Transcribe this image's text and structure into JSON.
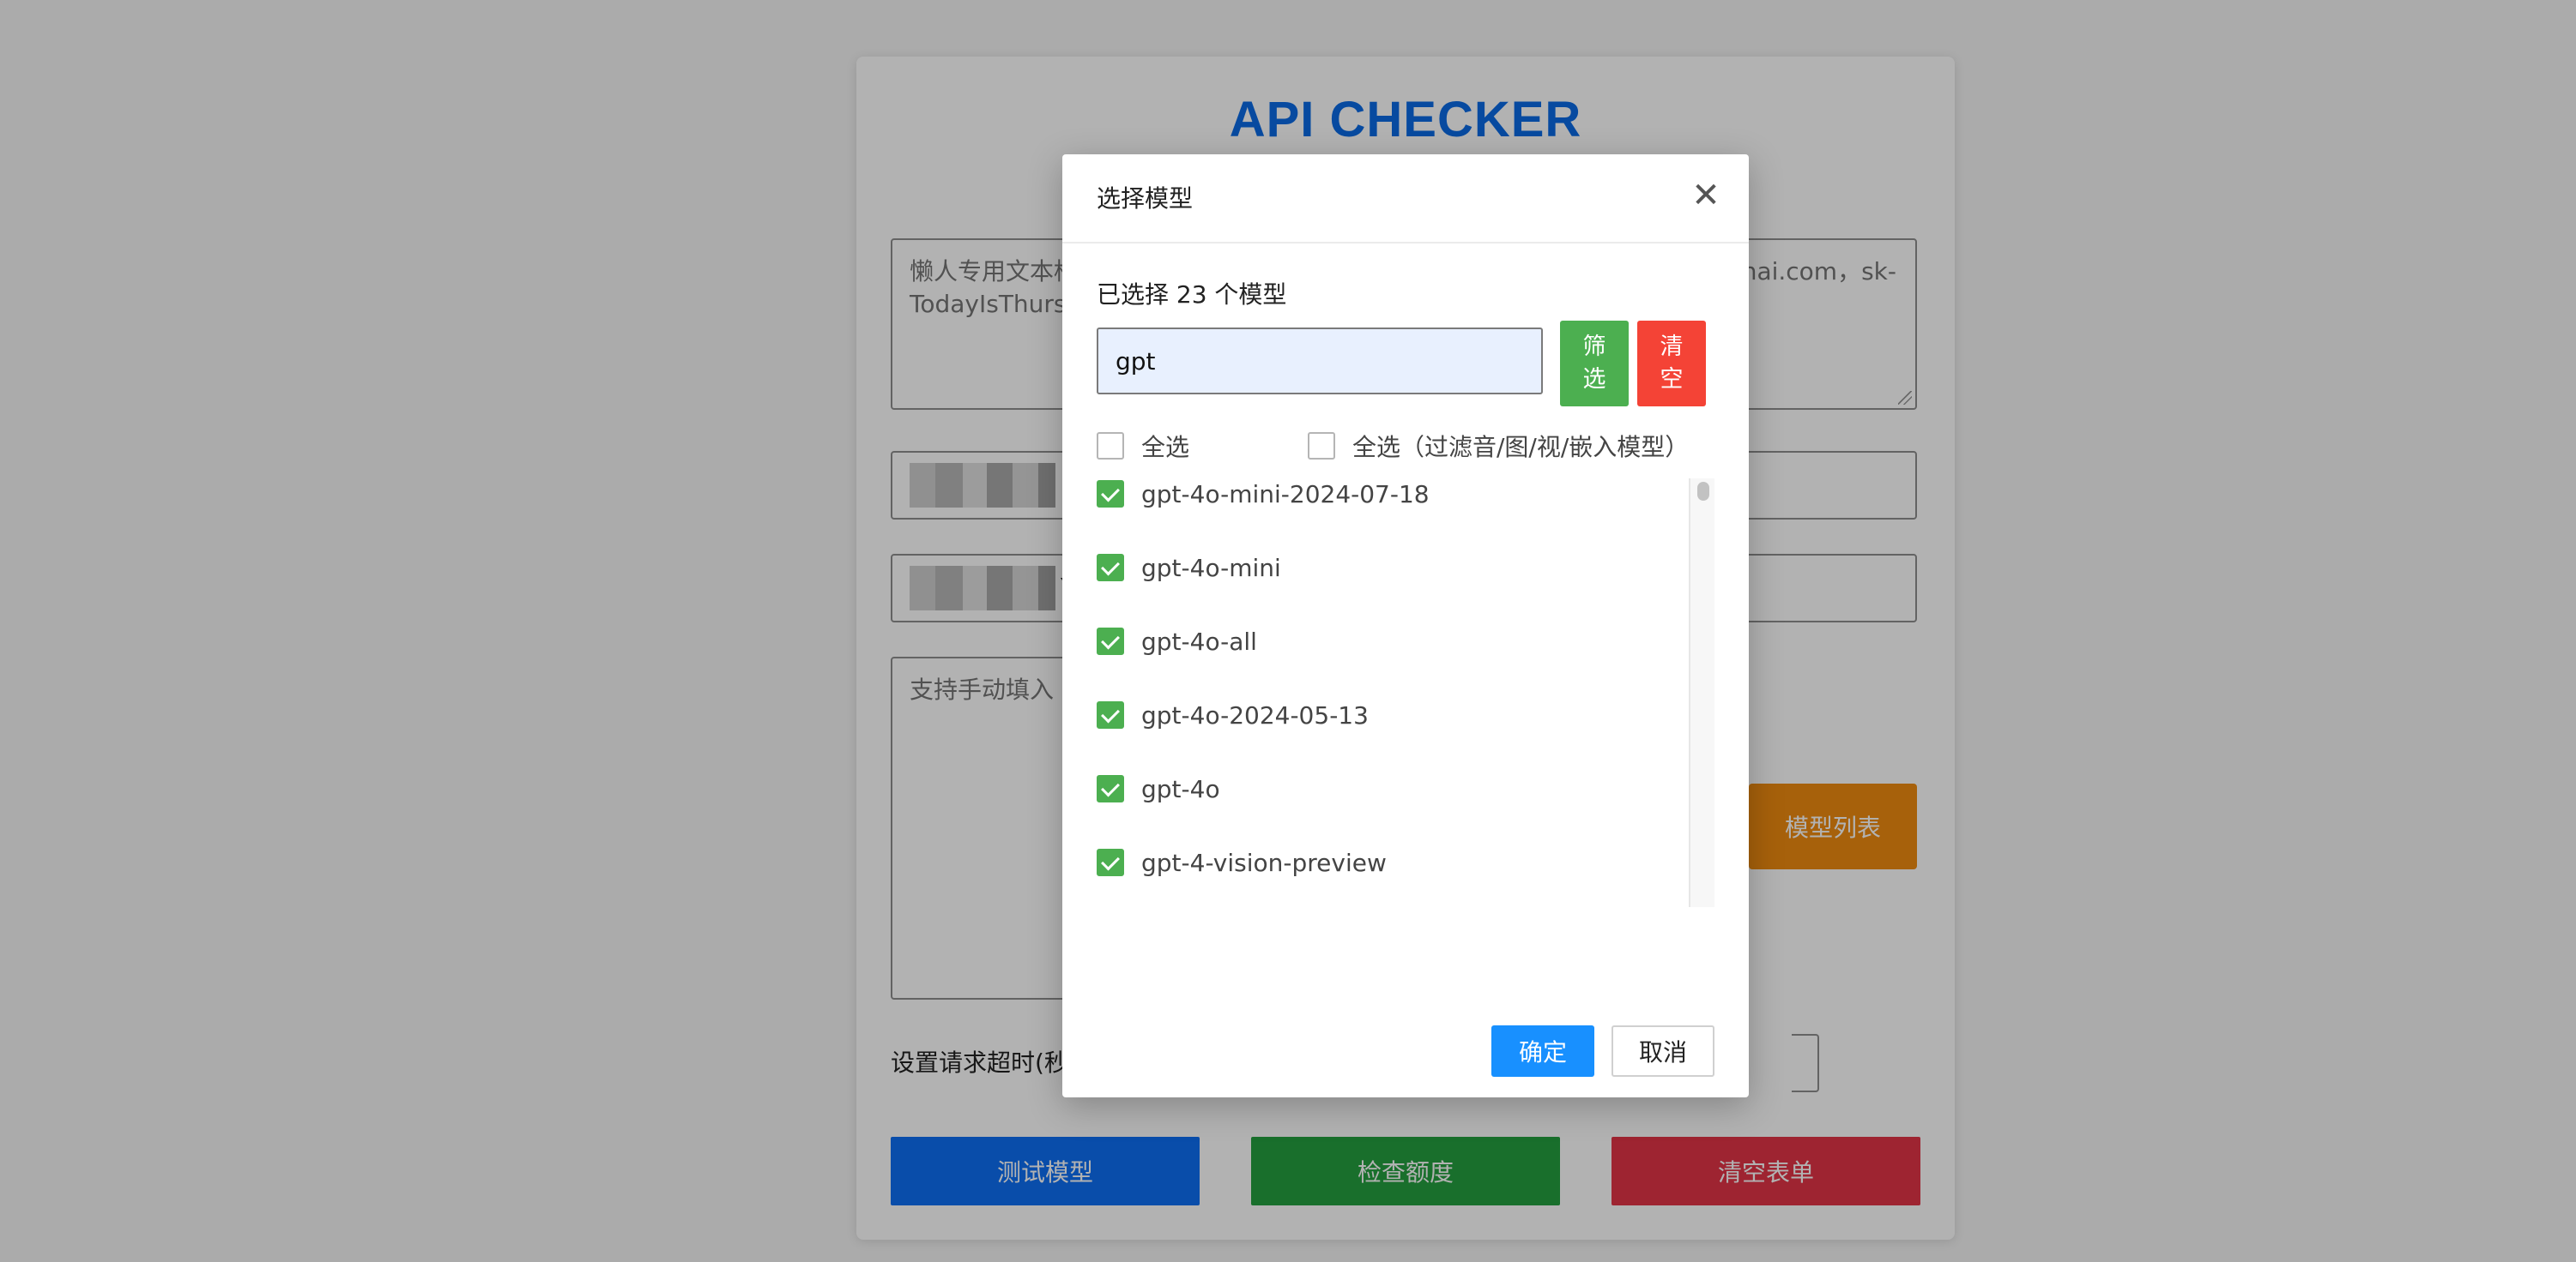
{
  "page": {
    "title": "API CHECKER",
    "bulk_text_placeholder": "懒人专用文本框",
    "bulk_text_fragment": "TodayIsThursd",
    "bulk_text_right": "enai.com，sk-",
    "url_field_tail": "",
    "key_field_tail": "Y",
    "models_textarea_placeholder": "支持手动填入",
    "get_models_label": "模型列表",
    "timeout_label": "设置请求超时(秒",
    "buttons": {
      "test": "测试模型",
      "quota": "检查额度",
      "clear": "清空表单"
    }
  },
  "modal": {
    "title": "选择模型",
    "close_symbol": "✕",
    "selected_count_text": "已选择 23 个模型",
    "filter_value": "gpt",
    "filter_button": "筛选",
    "clear_button": "清空",
    "select_all_label": "全选",
    "select_all_filtered_label": "全选（过滤音/图/视/嵌入模型）",
    "models": [
      {
        "name": "gpt-4o-mini-2024-07-18",
        "checked": true
      },
      {
        "name": "gpt-4o-mini",
        "checked": true
      },
      {
        "name": "gpt-4o-all",
        "checked": true
      },
      {
        "name": "gpt-4o-2024-05-13",
        "checked": true
      },
      {
        "name": "gpt-4o",
        "checked": true
      },
      {
        "name": "gpt-4-vision-preview",
        "checked": true
      }
    ],
    "ok_button": "确定",
    "cancel_button": "取消"
  },
  "colors": {
    "title_blue": "#0b6be6",
    "check_green": "#4caf50",
    "filter_green": "#4caf50",
    "clear_red": "#f44336",
    "ok_blue": "#1890ff",
    "orange": "#f08c10"
  }
}
